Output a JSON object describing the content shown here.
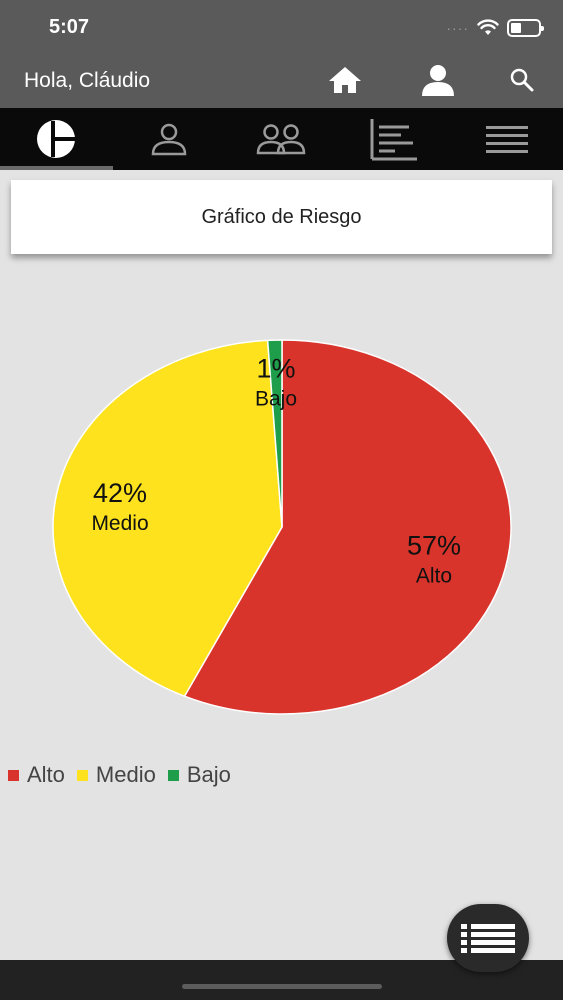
{
  "status_bar": {
    "time": "5:07",
    "signal": "····"
  },
  "header": {
    "greeting": "Hola, Cláudio"
  },
  "icons": {
    "home": "home-icon",
    "profile": "user-icon",
    "search": "search-icon",
    "tabs": [
      "logo-icon",
      "user-icon",
      "users-icon",
      "report-icon",
      "menu-icon"
    ],
    "fab": "list-icon"
  },
  "card": {
    "title": "Gráfico de Riesgo"
  },
  "colors": {
    "alto": "#d9342b",
    "medio": "#fde21d",
    "bajo": "#1e9e4a",
    "header": "#5a5a5a",
    "tabbar": "#0a0a0a"
  },
  "chart_data": {
    "type": "pie",
    "slices": [
      {
        "label": "Alto",
        "value": 57,
        "display": "57%",
        "color": "#d9342b"
      },
      {
        "label": "Medio",
        "value": 42,
        "display": "42%",
        "color": "#fde21d"
      },
      {
        "label": "Bajo",
        "value": 1,
        "display": "1%",
        "color": "#1e9e4a"
      }
    ],
    "legend_position": "bottom-left"
  }
}
